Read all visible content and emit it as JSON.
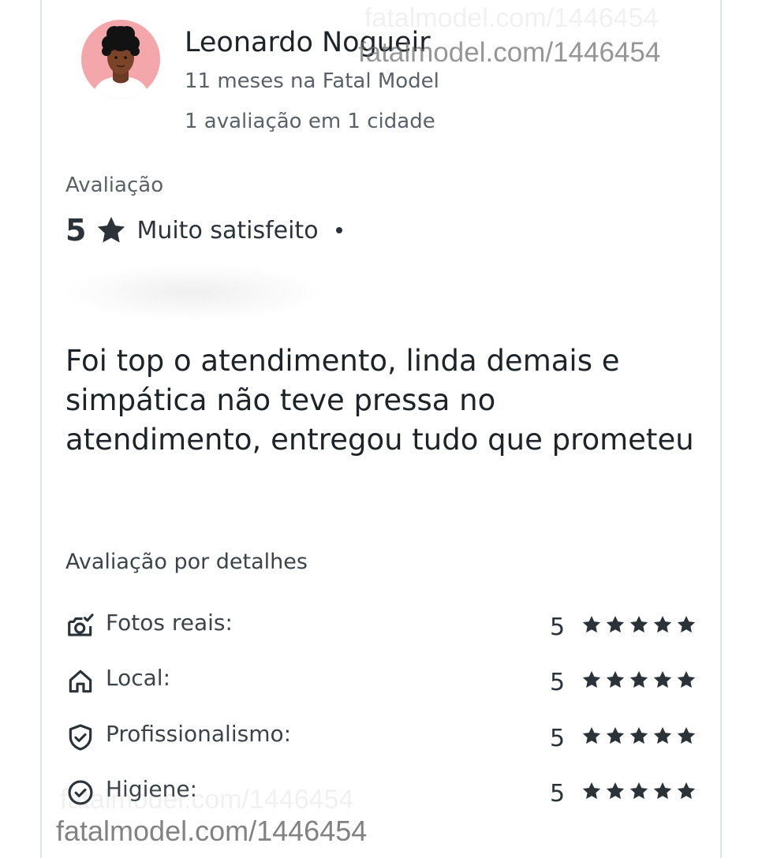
{
  "user": {
    "name": "Leonardo Nogueir",
    "tenure": "11 meses na Fatal Model",
    "reviews_count": "1 avaliação em 1 cidade"
  },
  "watermark": {
    "text": "fatalmodel.com/1446454"
  },
  "rating": {
    "label": "Avaliação",
    "score": "5",
    "text": "Muito satisfeito"
  },
  "review": {
    "text": "Foi top o atendimento, linda demais e simpática não teve pressa no atendimento, entregou tudo que prometeu"
  },
  "details": {
    "title": "Avaliação por detalhes",
    "items": [
      {
        "icon": "camera-icon",
        "label": "Fotos reais:",
        "score": "5",
        "stars": 5
      },
      {
        "icon": "home-icon",
        "label": "Local:",
        "score": "5",
        "stars": 5
      },
      {
        "icon": "shield-check-icon",
        "label": "Profissionalismo:",
        "score": "5",
        "stars": 5
      },
      {
        "icon": "check-circle-icon",
        "label": "Higiene:",
        "score": "5",
        "stars": 5
      }
    ]
  },
  "colors": {
    "avatar_bg": "#f4a7ab",
    "text_dark": "#2b3338"
  }
}
